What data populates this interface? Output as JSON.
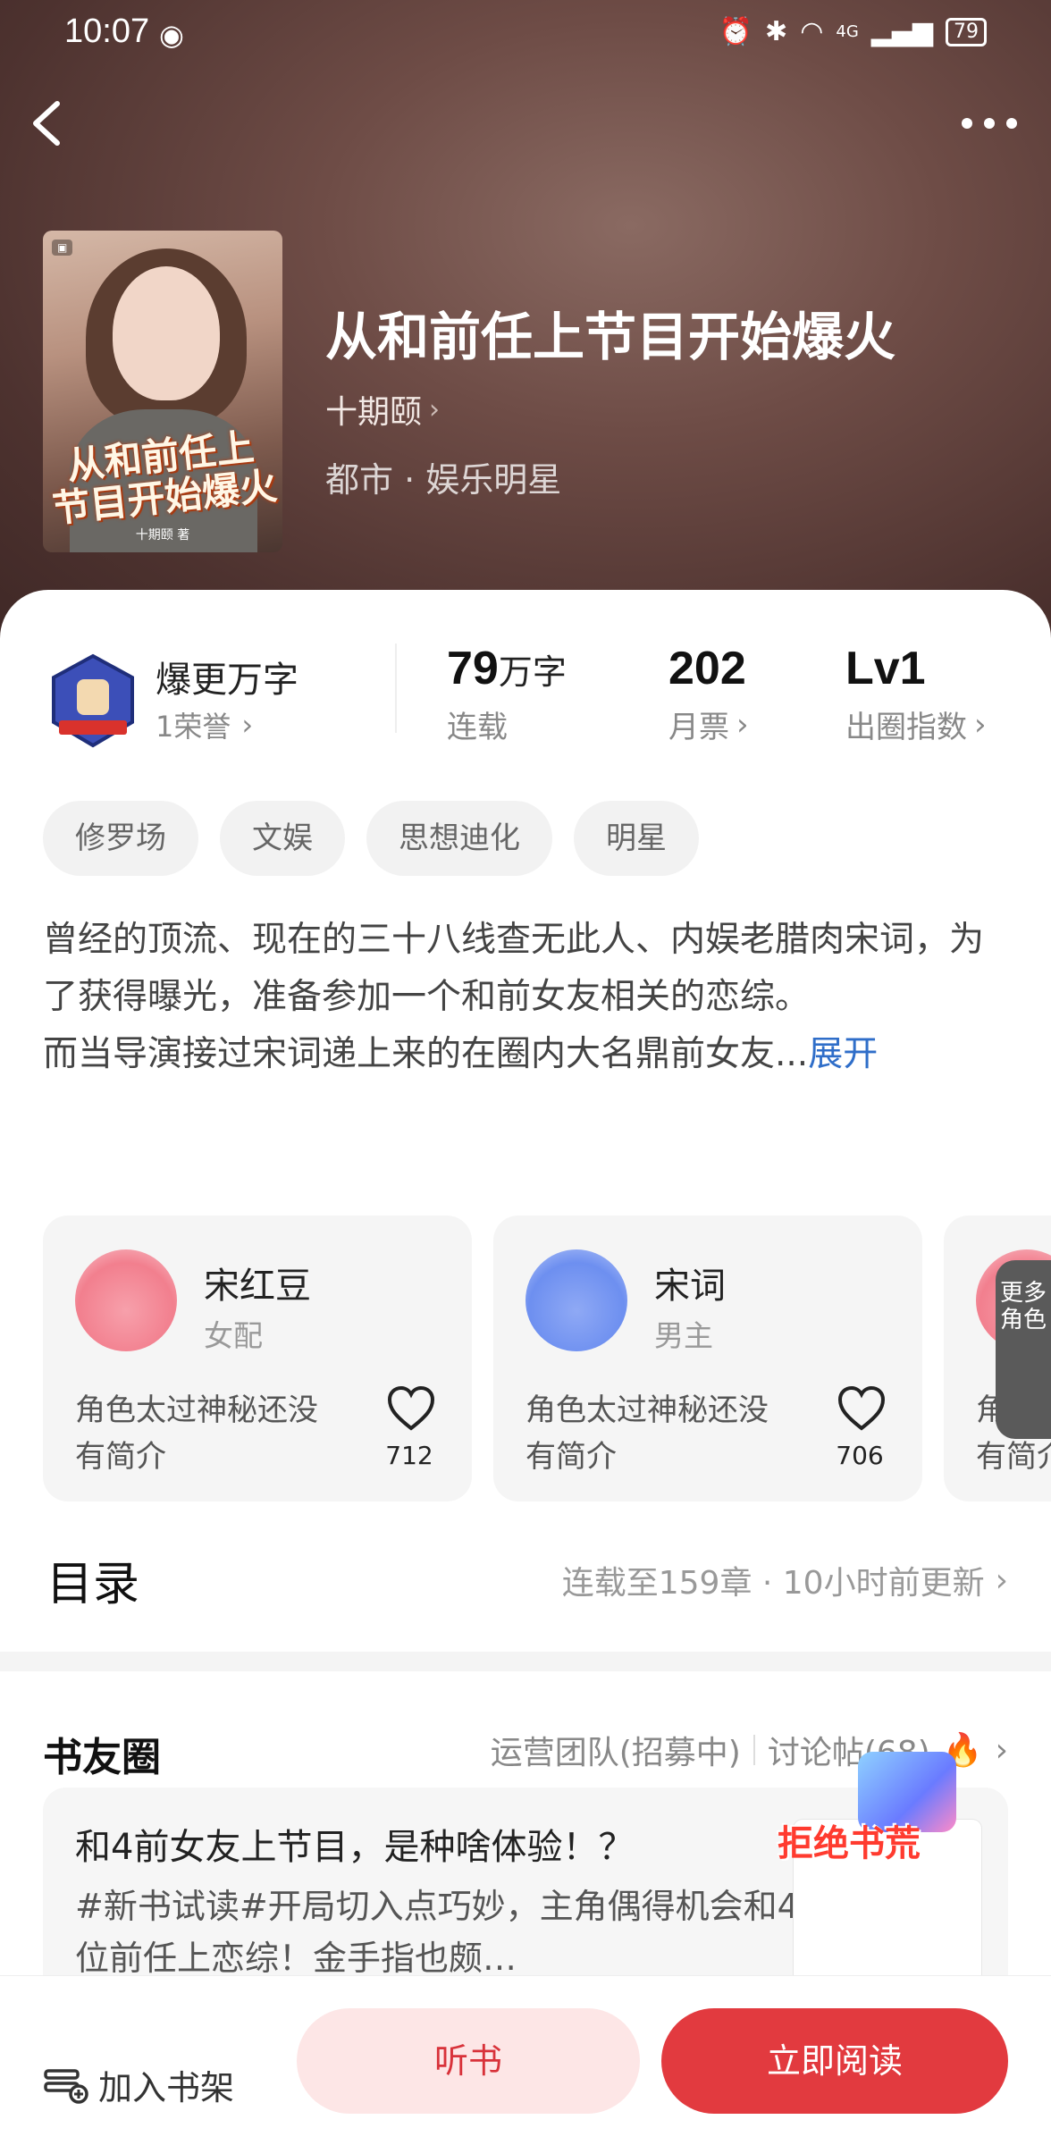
{
  "status_bar": {
    "time": "10:07",
    "battery": "79",
    "signal": "4G"
  },
  "book": {
    "title": "从和前任上节目开始爆火",
    "author": "十期颐",
    "genre": "都市 · 娱乐明星",
    "cover_title_line1": "从和前任上",
    "cover_title_line2": "节目开始爆火",
    "cover_author": "十期颐 著"
  },
  "honor": {
    "title": "爆更万字",
    "count_label": "1荣誉"
  },
  "stats": [
    {
      "value": "79",
      "unit": "万字",
      "label": "连载"
    },
    {
      "value": "202",
      "unit": "",
      "label": "月票"
    },
    {
      "value": "Lv1",
      "unit": "",
      "label": "出圈指数"
    }
  ],
  "tags": [
    "修罗场",
    "文娱",
    "思想迪化",
    "明星"
  ],
  "synopsis": {
    "text": "曾经的顶流、现在的三十八线查无此人、内娱老腊肉宋词，为了获得曝光，准备参加一个和前女友相关的恋综。\n而当导演接过宋词递上来的在圈内大名鼎前女友...",
    "expand_label": "展开"
  },
  "roles": [
    {
      "name": "宋红豆",
      "type": "女配",
      "desc": "角色太过神秘还没有简介",
      "likes": "712",
      "avatar_color": "#f27f8e"
    },
    {
      "name": "宋词",
      "type": "男主",
      "desc": "角色太过神秘还没有简介",
      "likes": "706",
      "avatar_color": "#6d8ff0"
    },
    {
      "name": "",
      "type": "",
      "desc": "角色太过神秘还没有简介",
      "likes": "",
      "avatar_color": "#f27f8e"
    }
  ],
  "more_roles_label": "更多角色",
  "toc": {
    "title": "目录",
    "info": "连载至159章 · 10小时前更新"
  },
  "circle": {
    "title": "书友圈",
    "team_link": "运营团队(招募中)",
    "forum_link": "讨论帖(68)",
    "post_title": "和4前女友上节目，是种啥体验！？",
    "post_text": "#新书试读#开局切入点巧妙，主角偶得机会和4位前任上恋综！金手指也颇…"
  },
  "promo_label": "拒绝书荒",
  "bottom_bar": {
    "shelf_label": "加入书架",
    "listen_label": "听书",
    "read_label": "立即阅读"
  }
}
